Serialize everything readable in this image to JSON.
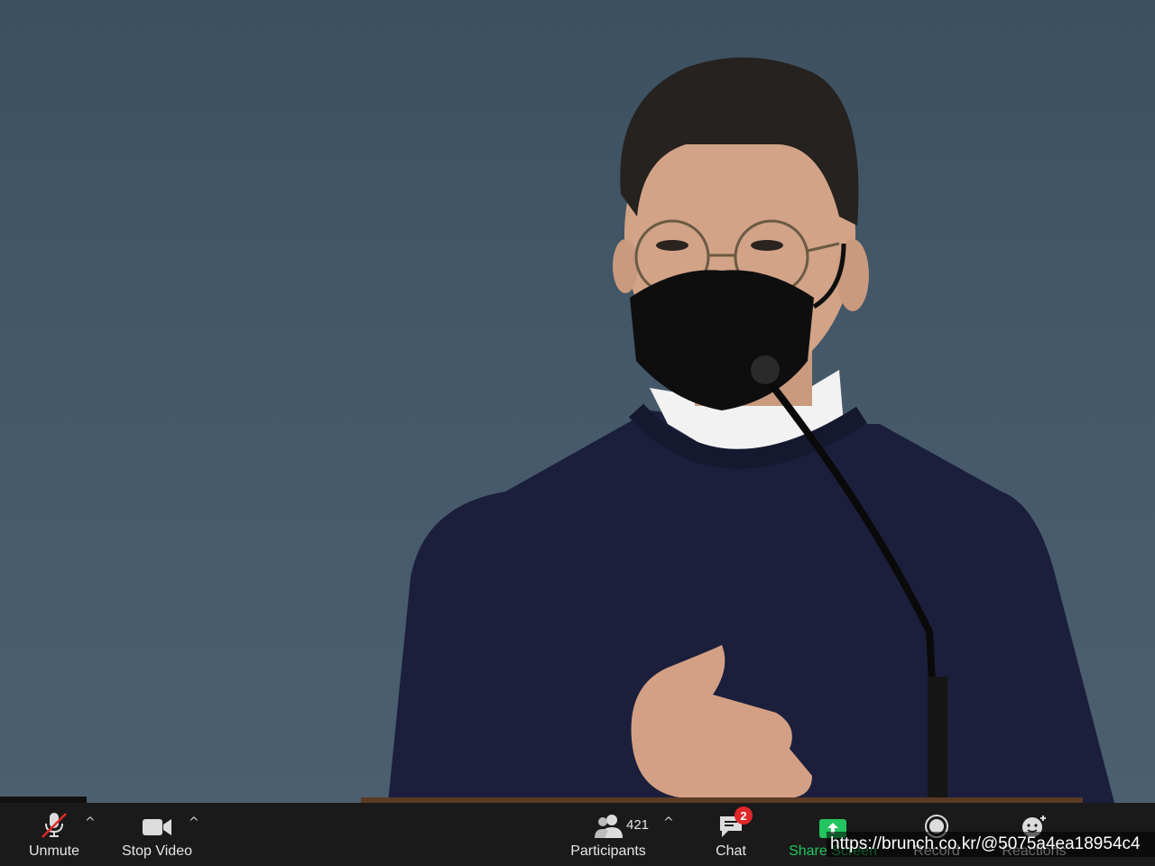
{
  "toolbar": {
    "unmute": {
      "label": "Unmute",
      "icon": "muted-mic-icon"
    },
    "stop_video": {
      "label": "Stop Video",
      "icon": "video-camera-icon"
    },
    "participants": {
      "label": "Participants",
      "count": "421",
      "icon": "participants-icon"
    },
    "chat": {
      "label": "Chat",
      "badge": "2",
      "icon": "chat-bubble-icon"
    },
    "share_screen": {
      "label": "Share Screen",
      "icon": "share-screen-icon",
      "color": "#22c55e"
    },
    "record": {
      "label": "Record",
      "icon": "record-icon"
    },
    "reactions": {
      "label": "Reactions",
      "icon": "reactions-icon"
    }
  },
  "watermark": {
    "text": "https://brunch.co.kr/@5075a4ea18954c4"
  },
  "colors": {
    "background": "#3f5362",
    "toolbar": "#1a1a1a",
    "sweater": "#1b1f3b",
    "badge": "#e02828"
  }
}
